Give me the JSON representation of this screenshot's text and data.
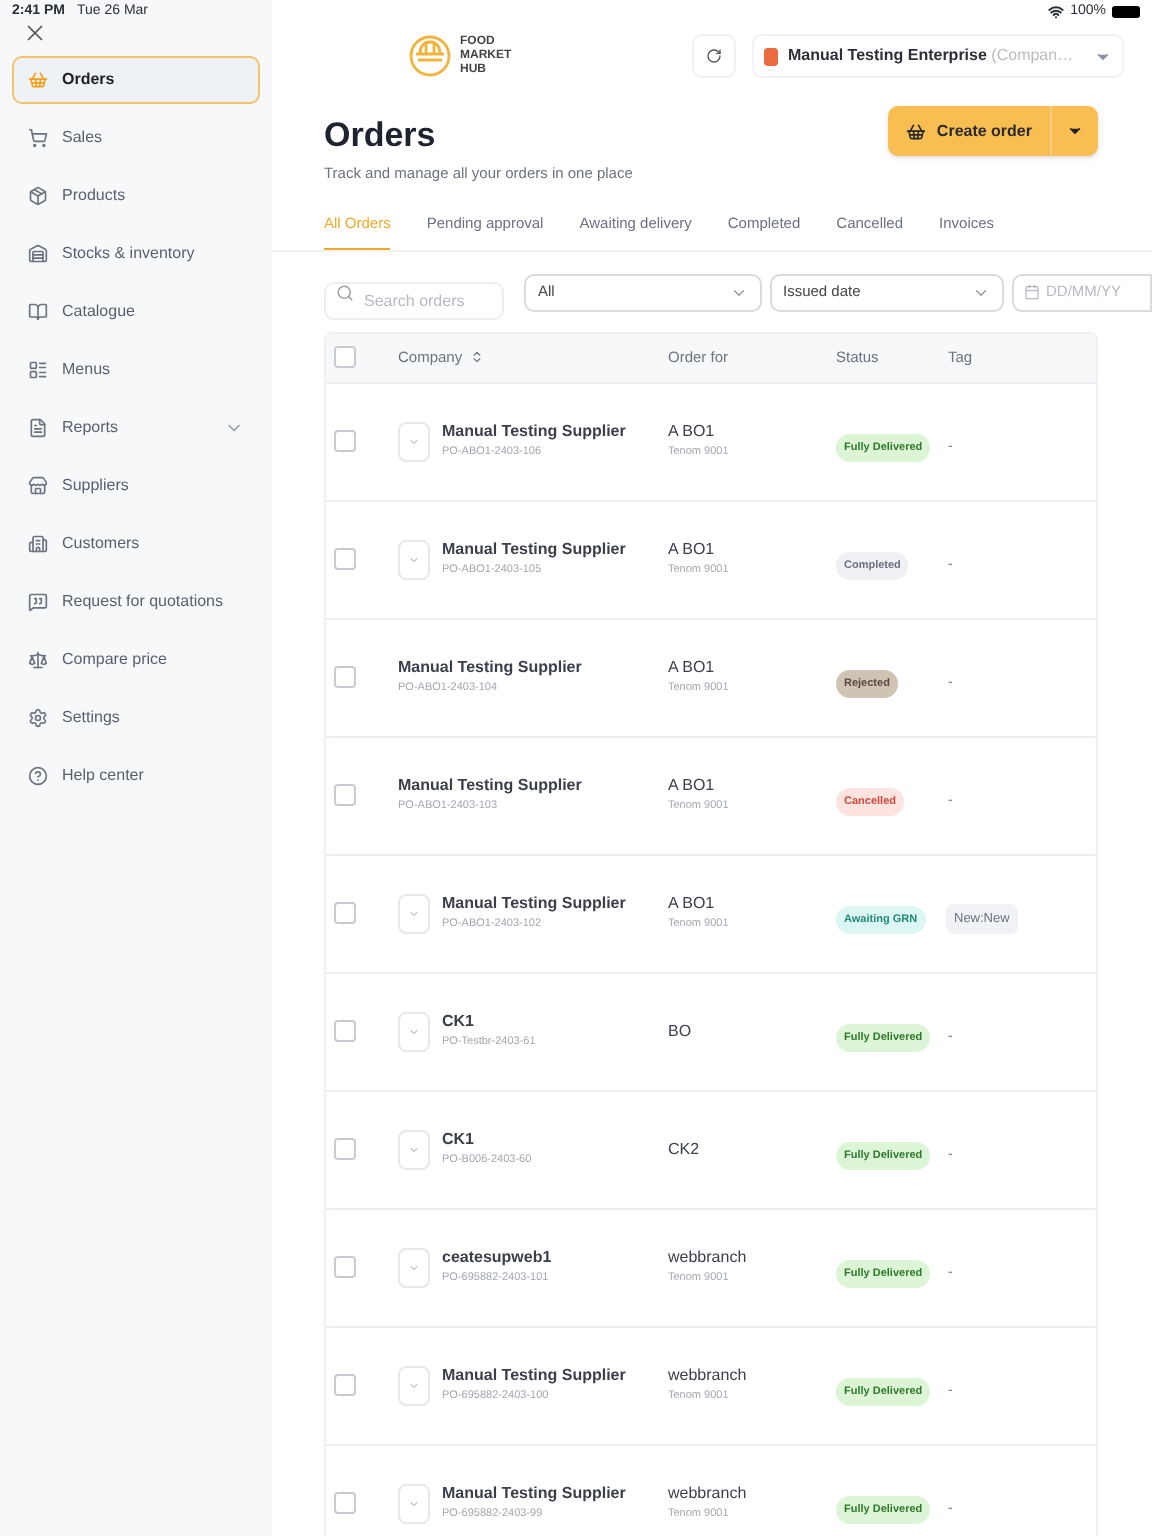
{
  "status_bar": {
    "time": "2:41 PM",
    "date": "Tue 26 Mar",
    "battery": "100%"
  },
  "sidebar": {
    "items": [
      {
        "label": "Orders",
        "selected": true
      },
      {
        "label": "Sales",
        "selected": false
      },
      {
        "label": "Products",
        "selected": false
      },
      {
        "label": "Stocks & inventory",
        "selected": false
      },
      {
        "label": "Catalogue",
        "selected": false
      },
      {
        "label": "Menus",
        "selected": false
      },
      {
        "label": "Reports",
        "selected": false,
        "expanded": false
      },
      {
        "label": "Suppliers",
        "selected": false
      },
      {
        "label": "Customers",
        "selected": false
      },
      {
        "label": "Request for quotations",
        "selected": false
      },
      {
        "label": "Compare price",
        "selected": false
      },
      {
        "label": "Settings",
        "selected": false
      },
      {
        "label": "Help center",
        "selected": false
      }
    ]
  },
  "header": {
    "logo_lines": [
      "FOOD",
      "MARKET",
      "HUB"
    ],
    "company": "Manual Testing Enterprise",
    "company_note": "(Compan…"
  },
  "page": {
    "title": "Orders",
    "subtitle": "Track and manage all your orders in one place",
    "create_button": "Create order"
  },
  "tabs": [
    {
      "label": "All Orders",
      "selected": true
    },
    {
      "label": "Pending approval",
      "selected": false
    },
    {
      "label": "Awaiting delivery",
      "selected": false
    },
    {
      "label": "Completed",
      "selected": false
    },
    {
      "label": "Cancelled",
      "selected": false
    },
    {
      "label": "Invoices",
      "selected": false
    }
  ],
  "filters": {
    "search": {
      "placeholder": "Search orders"
    },
    "type": {
      "value": "All"
    },
    "date_type": {
      "value": "Issued date"
    },
    "date": {
      "placeholder": "DD/MM/YY"
    }
  },
  "table": {
    "select_all_checked": false,
    "columns": [
      "Company",
      "Order for",
      "Status",
      "Tag"
    ],
    "rows": [
      {
        "checked": false,
        "expandable": true,
        "company": "Manual Testing Supplier",
        "order_no": "PO-ABO1-2403-106",
        "order_for": "A BO1",
        "branch": "Tenom 9001",
        "status": {
          "label": "Fully Delivered",
          "kind": "delivered"
        },
        "tag": "-"
      },
      {
        "checked": false,
        "expandable": true,
        "company": "Manual Testing Supplier",
        "order_no": "PO-ABO1-2403-105",
        "order_for": "A BO1",
        "branch": "Tenom 9001",
        "status": {
          "label": "Completed",
          "kind": "completed"
        },
        "tag": "-"
      },
      {
        "checked": false,
        "expandable": false,
        "company": "Manual Testing Supplier",
        "order_no": "PO-ABO1-2403-104",
        "order_for": "A BO1",
        "branch": "Tenom 9001",
        "status": {
          "label": "Rejected",
          "kind": "rejected"
        },
        "tag": "-"
      },
      {
        "checked": false,
        "expandable": false,
        "company": "Manual Testing Supplier",
        "order_no": "PO-ABO1-2403-103",
        "order_for": "A BO1",
        "branch": "Tenom 9001",
        "status": {
          "label": "Cancelled",
          "kind": "cancelled"
        },
        "tag": "-"
      },
      {
        "checked": false,
        "expandable": true,
        "company": "Manual Testing Supplier",
        "order_no": "PO-ABO1-2403-102",
        "order_for": "A BO1",
        "branch": "Tenom 9001",
        "status": {
          "label": "Awaiting GRN",
          "kind": "awaiting"
        },
        "tag": {
          "label": "New:New",
          "kind": "badge"
        }
      },
      {
        "checked": false,
        "expandable": true,
        "company": "CK1",
        "order_no": "PO-Testbr-2403-61",
        "order_for": "BO",
        "status": {
          "label": "Fully Delivered",
          "kind": "delivered"
        },
        "tag": "-"
      },
      {
        "checked": false,
        "expandable": true,
        "company": "CK1",
        "order_no": "PO-B006-2403-60",
        "order_for": "CK2",
        "status": {
          "label": "Fully Delivered",
          "kind": "delivered"
        },
        "tag": "-"
      },
      {
        "checked": false,
        "expandable": true,
        "company": "ceatesupweb1",
        "order_no": "PO-695882-2403-101",
        "order_for": "webbranch",
        "branch": "Tenom 9001",
        "status": {
          "label": "Fully Delivered",
          "kind": "delivered"
        },
        "tag": "-"
      },
      {
        "checked": false,
        "expandable": true,
        "company": "Manual Testing Supplier",
        "order_no": "PO-695882-2403-100",
        "order_for": "webbranch",
        "branch": "Tenom 9001",
        "status": {
          "label": "Fully Delivered",
          "kind": "delivered"
        },
        "tag": "-"
      },
      {
        "checked": false,
        "expandable": true,
        "company": "Manual Testing Supplier",
        "order_no": "PO-695882-2403-99",
        "order_for": "webbranch",
        "branch": "Tenom 9001",
        "status": {
          "label": "Fully Delivered",
          "kind": "delivered"
        },
        "tag": "-"
      }
    ]
  }
}
